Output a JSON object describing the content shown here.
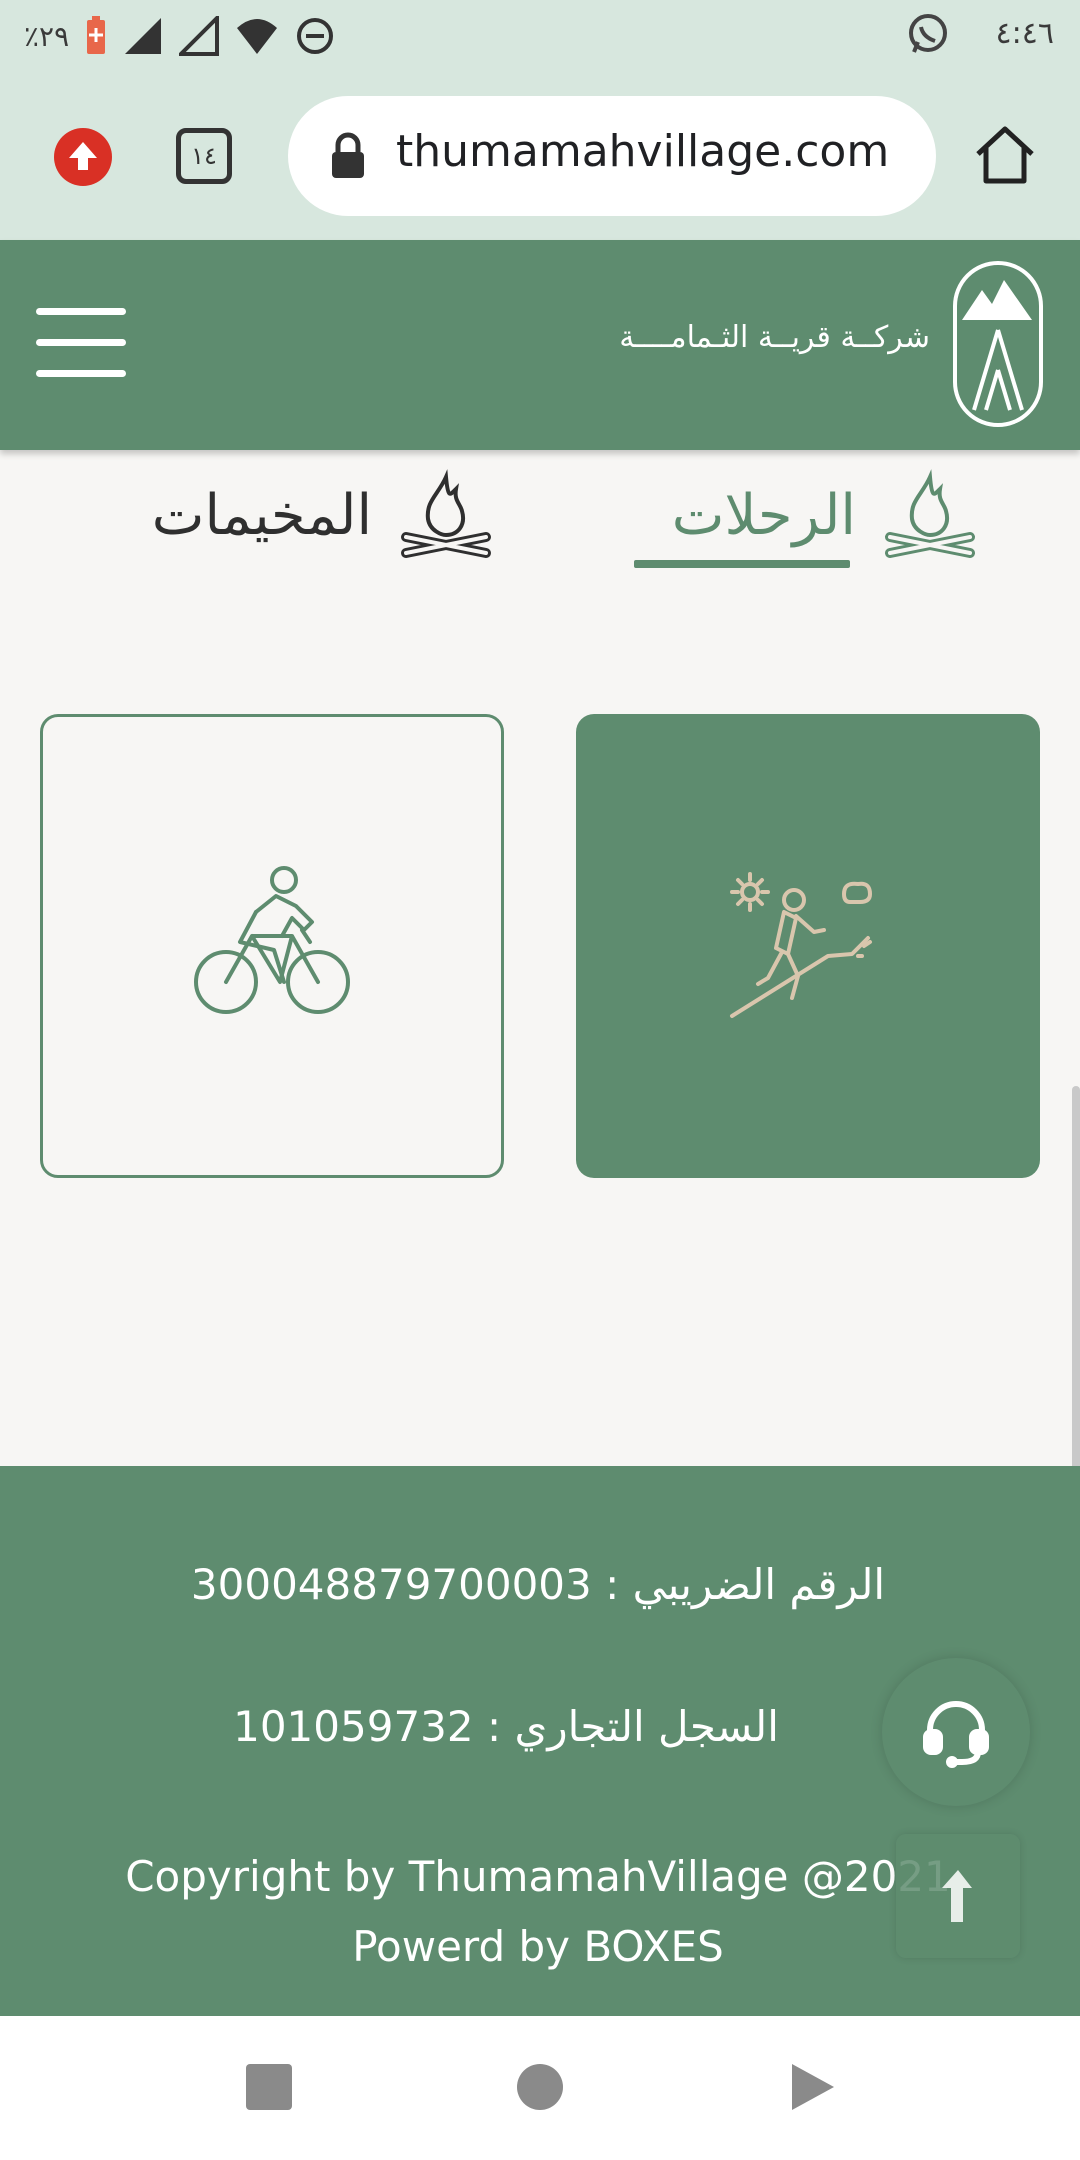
{
  "status_bar": {
    "time": "٤:٤٦",
    "battery": "٪٢٩"
  },
  "browser": {
    "url": "thumamahvillage.com",
    "tab_count": "١٤"
  },
  "header": {
    "company_name": "شركــة قريــة الثـمامــــة"
  },
  "tabs": [
    {
      "label": "الرحلات",
      "icon": "campfire-icon",
      "active": true
    },
    {
      "label": "المخيمات",
      "icon": "campfire-icon",
      "active": false
    }
  ],
  "cards": [
    {
      "icon": "hiking-icon",
      "selected": true
    },
    {
      "icon": "cycling-icon",
      "selected": false
    }
  ],
  "footer": {
    "tax_number": "الرقم الضريبي : 300048879700003",
    "commercial_register": "السجل التجاري : 101059732",
    "copyright": "Copyright by ThumamahVillage @2021",
    "powered": "Powerd by BOXES"
  },
  "colors": {
    "brand_green": "#5e8c6f",
    "chrome_bg": "#d7e7de",
    "page_bg": "#f7f6f4",
    "hike_icon": "#d9c6ad"
  }
}
